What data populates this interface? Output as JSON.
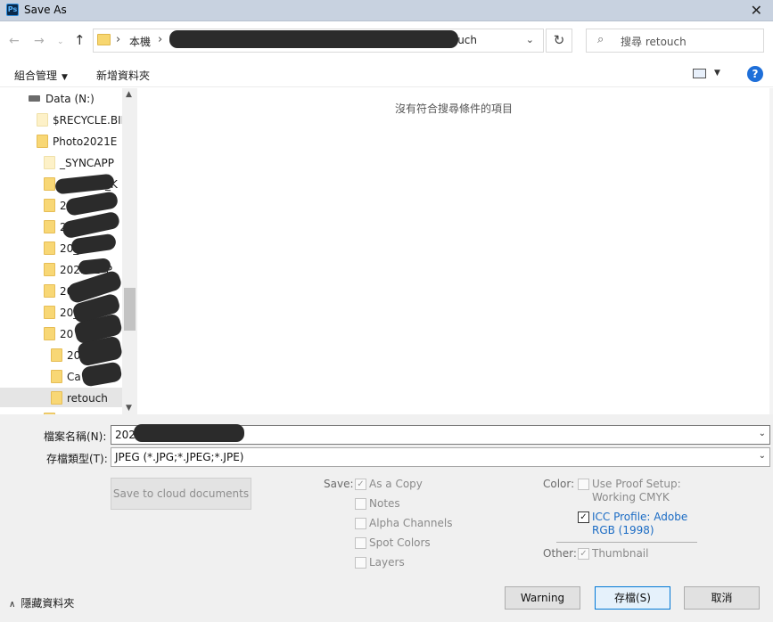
{
  "window": {
    "title": "Save As",
    "app_icon": "Ps",
    "close_glyph": "✕"
  },
  "nav": {
    "back_glyph": "←",
    "forward_glyph": "→",
    "recent_glyph": "⌄",
    "up_glyph": "↑",
    "address": {
      "root": "本機",
      "sep": "›",
      "current": "uch"
    },
    "address_chevron": "⌄",
    "refresh_glyph": "↻",
    "search_placeholder": "搜尋 retouch"
  },
  "toolbar": {
    "organize": "組合管理",
    "new_folder": "新增資料夾",
    "help": "?"
  },
  "tree": {
    "items": [
      {
        "label": "Data (N:)"
      },
      {
        "label": "$RECYCLE.BIN"
      },
      {
        "label": "Photo2021E"
      },
      {
        "label": "_SYNCAPP"
      },
      {
        "label": "_K"
      },
      {
        "label": "20_K"
      },
      {
        "label": "20"
      },
      {
        "label": "20_Lo"
      },
      {
        "label": "202112_P"
      },
      {
        "label": "2021"
      },
      {
        "label": "20_B"
      },
      {
        "label": "20"
      },
      {
        "label": "202"
      },
      {
        "label": "Ca"
      },
      {
        "label": "retouch"
      }
    ],
    "scroll_up": "▲",
    "scroll_down": "▼"
  },
  "main": {
    "empty_message": "沒有符合搜尋條件的項目"
  },
  "form": {
    "filename_label": "檔案名稱(N):",
    "filename_value": "202 .jpg",
    "filetype_label": "存檔類型(T):",
    "filetype_value": "JPEG (*.JPG;*.JPEG;*.JPE)",
    "chevron": "⌄"
  },
  "options": {
    "cloud_button": "Save to cloud documents",
    "save_label": "Save:",
    "save_items": [
      {
        "label": "As a Copy",
        "checked": true
      },
      {
        "label": "Notes",
        "checked": false
      },
      {
        "label": "Alpha Channels",
        "checked": false
      },
      {
        "label": "Spot Colors",
        "checked": false
      },
      {
        "label": "Layers",
        "checked": false
      }
    ],
    "color_label": "Color:",
    "proof_setup_line1": "Use Proof Setup:",
    "proof_setup_line2": "Working CMYK",
    "icc_line1": "ICC Profile:  Adobe",
    "icc_line2": "RGB (1998)",
    "other_label": "Other:",
    "thumbnail": "Thumbnail",
    "check_glyph": "✓"
  },
  "footer": {
    "hide_folders": "隱藏資料夾",
    "hide_caret": "∧",
    "warning": "Warning",
    "save": "存檔(S)",
    "cancel": "取消"
  },
  "colors": {
    "titlebar": "#c8d2e0",
    "accent": "#0078d7",
    "folder": "#f8d775",
    "icc_text": "#1a6bc4"
  }
}
